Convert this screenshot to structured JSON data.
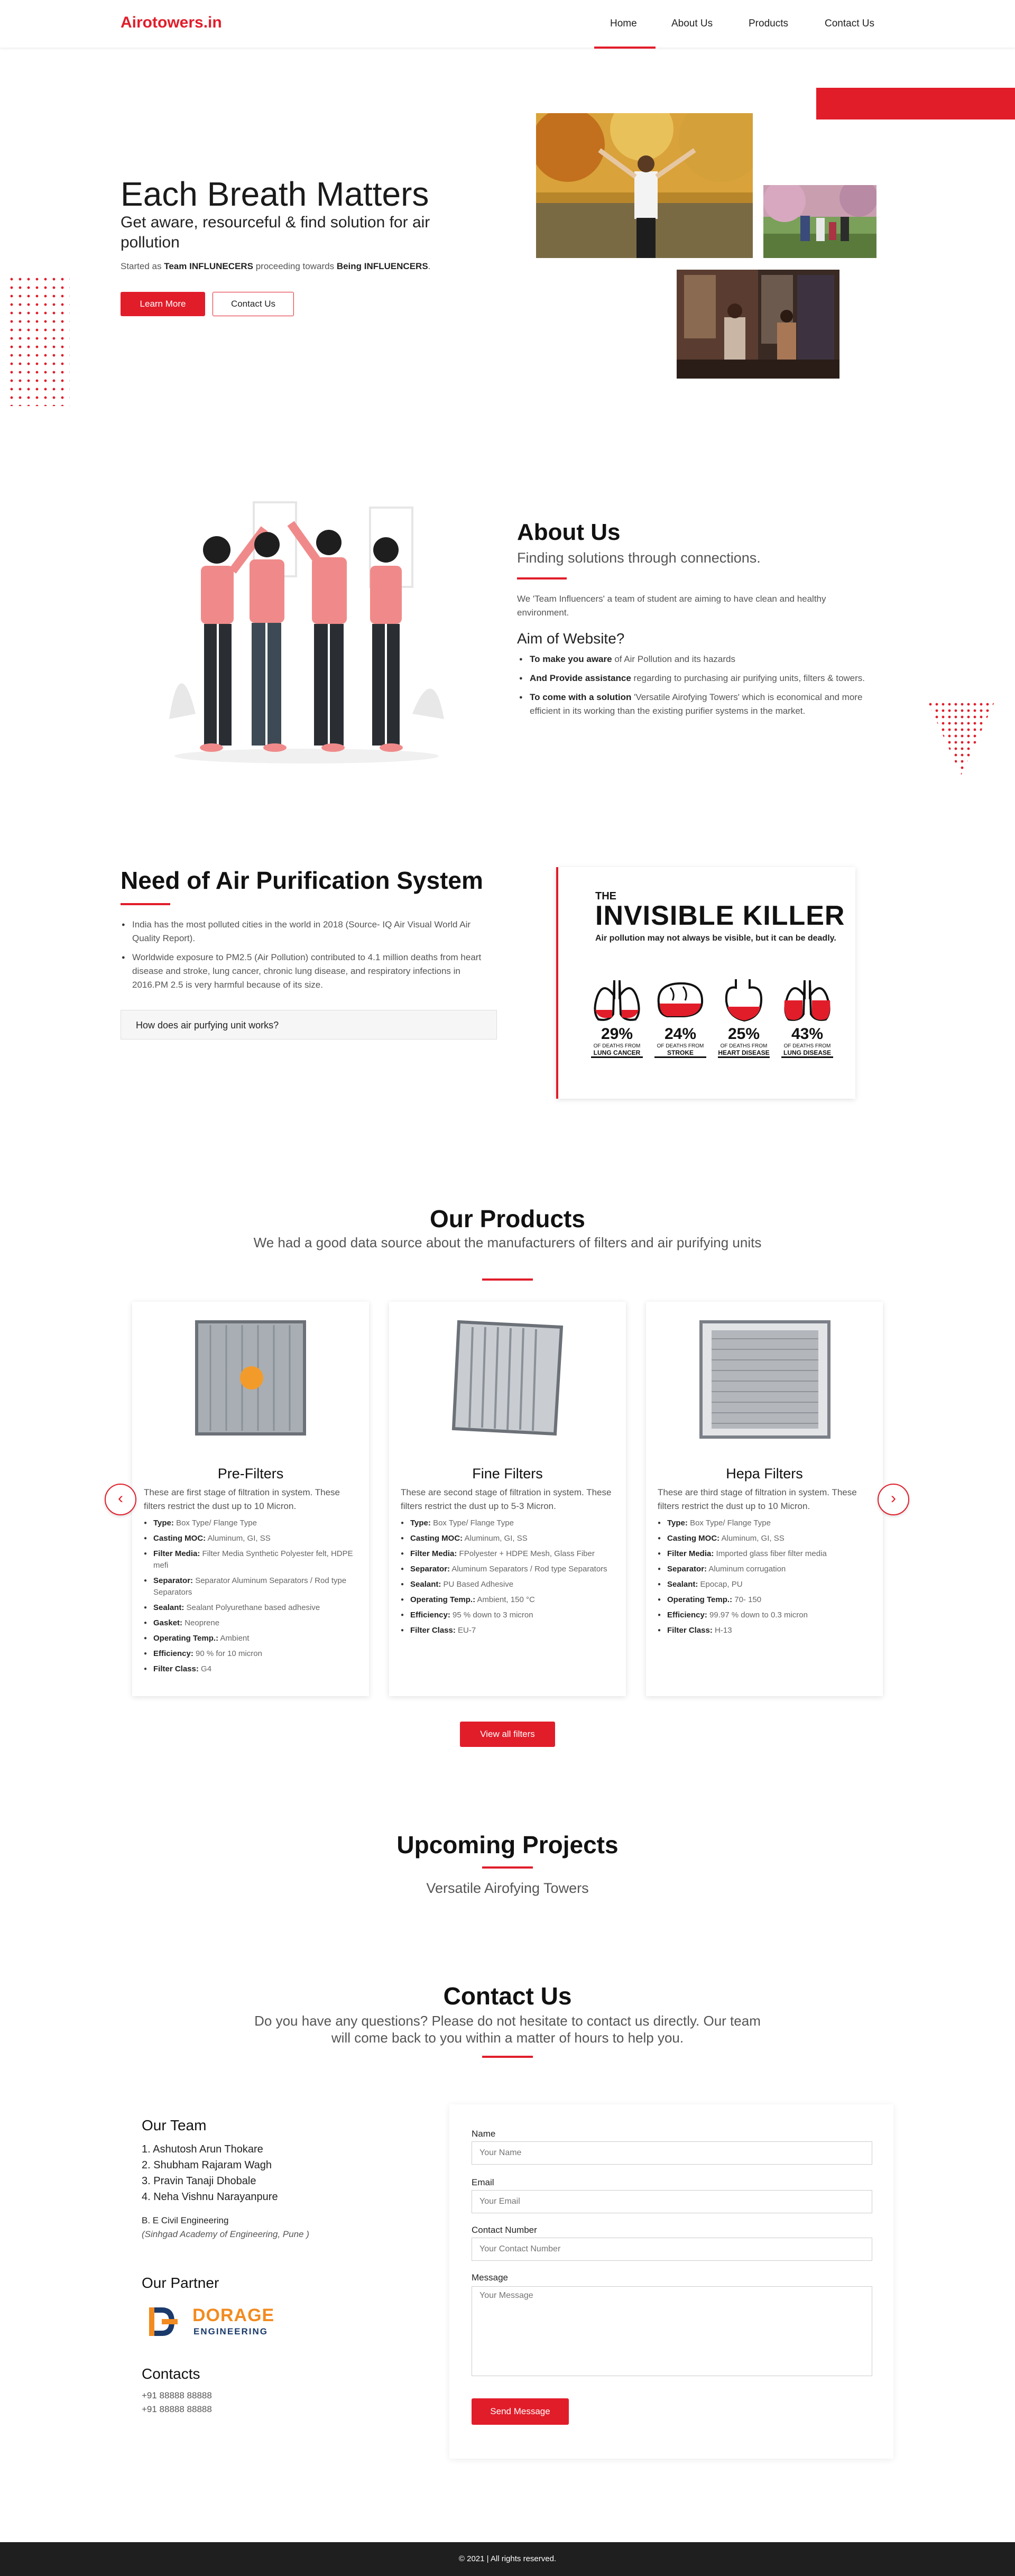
{
  "nav": {
    "brand": "Airotowers.in",
    "links": [
      "Home",
      "About Us",
      "Products",
      "Contact Us"
    ]
  },
  "hero": {
    "title": "Each Breath Matters",
    "subtitle": "Get aware, resourceful & find solution for air pollution",
    "small_prefix": "Started as ",
    "small_bold1": "Team INFLUNECERS",
    "small_mid": " proceeding towards ",
    "small_bold2": "Being INFLUENCERS",
    "small_suffix": ".",
    "learn_more": "Learn More",
    "contact_us": "Contact Us"
  },
  "about": {
    "title": "About Us",
    "subtitle": "Finding solutions through connections.",
    "desc": "We 'Team Influencers' a team of student are aiming to have clean and healthy environment.",
    "aim_title": "Aim of Website?",
    "aims": [
      {
        "bold": "To make you aware",
        "text": " of Air Pollution and its hazards"
      },
      {
        "bold": "And Provide assistance",
        "text": " regarding to purchasing air purifying units, filters & towers."
      },
      {
        "bold": "To come with a solution",
        "text": " 'Versatile Airofying Towers' which is economical and more efficient in its working than the existing purifier systems in the market."
      }
    ]
  },
  "need": {
    "title": "Need of Air Purification System",
    "points": [
      "India has the most polluted cities in the world in 2018 (Source- IQ Air Visual World Air Quality Report).",
      "Worldwide exposure to PM2.5 (Air Pollution) contributed to 4.1 million deaths from heart disease and stroke, lung cancer, chronic lung disease, and respiratory infections in 2016.PM 2.5 is very harmful because of its size."
    ],
    "accordion": "How does air purfying unit works?",
    "poster": {
      "the": "THE",
      "title": "INVISIBLE KILLER",
      "tagline": "Air pollution may not always be visible, but it can be deadly.",
      "stats": [
        {
          "pct": "29%",
          "small": "OF DEATHS FROM",
          "label": "LUNG CANCER"
        },
        {
          "pct": "24%",
          "small": "OF DEATHS FROM",
          "label": "STROKE"
        },
        {
          "pct": "25%",
          "small": "OF DEATHS FROM",
          "label": "HEART DISEASE"
        },
        {
          "pct": "43%",
          "small": "OF DEATHS FROM",
          "label": "LUNG DISEASE"
        }
      ]
    }
  },
  "products": {
    "title": "Our Products",
    "subtitle": "We had a good data source about the manufacturers of filters and air purifying units",
    "view_all": "View all filters",
    "items": [
      {
        "name": "Pre-Filters",
        "desc": "These are first stage of filtration in system. These filters restrict the dust up to 10 Micron.",
        "specs": [
          {
            "k": "Type:",
            "v": " Box Type/ Flange Type"
          },
          {
            "k": "Casting MOC:",
            "v": " Aluminum, GI, SS"
          },
          {
            "k": "Filter Media:",
            "v": " Filter Media Synthetic Polyester felt, HDPE mefi"
          },
          {
            "k": "Separator:",
            "v": " Separator Aluminum Separators / Rod type Separators"
          },
          {
            "k": "Sealant:",
            "v": " Sealant Polyurethane based adhesive"
          },
          {
            "k": "Gasket:",
            "v": " Neoprene"
          },
          {
            "k": "Operating Temp.:",
            "v": " Ambient"
          },
          {
            "k": "Efficiency:",
            "v": " 90 % for 10 micron"
          },
          {
            "k": "Filter Class:",
            "v": " G4"
          }
        ]
      },
      {
        "name": "Fine Filters",
        "desc": "These are second stage of filtration in system. These filters restrict the dust up to 5-3 Micron.",
        "specs": [
          {
            "k": "Type:",
            "v": " Box Type/ Flange Type"
          },
          {
            "k": "Casting MOC:",
            "v": " Aluminum, GI, SS"
          },
          {
            "k": "Filter Media:",
            "v": " FPolyester + HDPE Mesh, Glass Fiber"
          },
          {
            "k": "Separator:",
            "v": " Aluminum Separators / Rod type Separators"
          },
          {
            "k": "Sealant:",
            "v": " PU Based Adhesive"
          },
          {
            "k": "Operating Temp.:",
            "v": " Ambient, 150 °C"
          },
          {
            "k": "Efficiency:",
            "v": " 95 % down to 3 micron"
          },
          {
            "k": "Filter Class:",
            "v": " EU-7"
          }
        ]
      },
      {
        "name": "Hepa Filters",
        "desc": "These are third stage of filtration in system. These filters restrict the dust up to 10 Micron.",
        "specs": [
          {
            "k": "Type:",
            "v": " Box Type/ Flange Type"
          },
          {
            "k": "Casting MOC:",
            "v": " Aluminum, GI, SS"
          },
          {
            "k": "Filter Media:",
            "v": " Imported glass fiber filter media"
          },
          {
            "k": "Separator:",
            "v": " Aluminum corrugation"
          },
          {
            "k": "Sealant:",
            "v": " Epocap, PU"
          },
          {
            "k": "Operating Temp.:",
            "v": " 70- 150"
          },
          {
            "k": "Efficiency:",
            "v": " 99.97 % down to 0.3 micron"
          },
          {
            "k": "Filter Class:",
            "v": " H-13"
          }
        ]
      }
    ]
  },
  "upcoming": {
    "title": "Upcoming Projects",
    "subtitle": "Versatile Airofying Towers"
  },
  "contact": {
    "title": "Contact Us",
    "subtitle": "Do you have any questions? Please do not hesitate to contact us directly. Our team will come back to you within a matter of hours to help you.",
    "team_title": "Our Team",
    "team": [
      "1. Ashutosh Arun Thokare",
      "2. Shubham Rajaram Wagh",
      "3. Pravin Tanaji Dhobale",
      "4. Neha Vishnu Narayanpure"
    ],
    "degree": "B. E Civil Engineering",
    "college": "(Sinhgad Academy of Engineering, Pune )",
    "partner_title": "Our Partner",
    "partner_logo_main": "DORAGE",
    "partner_logo_sub": "ENGINEERING",
    "contacts_title": "Contacts",
    "phones": [
      "+91 88888 88888",
      "+91 88888 88888"
    ],
    "form": {
      "name_label": "Name",
      "name_ph": "Your Name",
      "email_label": "Email",
      "email_ph": "Your Email",
      "phone_label": "Contact Number",
      "phone_ph": "Your Contact Number",
      "message_label": "Message",
      "message_ph": "Your Message",
      "send": "Send Message"
    }
  },
  "footer": {
    "text": "© 2021 | All rights reserved."
  },
  "colors": {
    "accent": "#e11d2a",
    "footer_bg": "#1f1f1f"
  }
}
